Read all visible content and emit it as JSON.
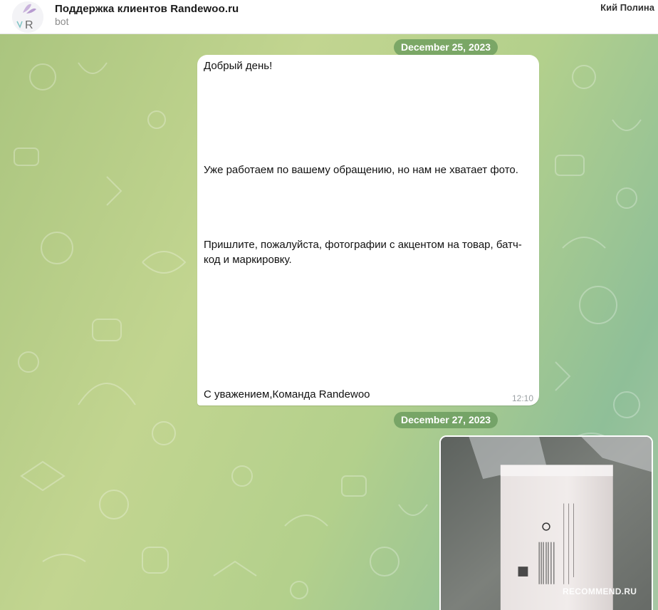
{
  "header": {
    "title": "Поддержка клиентов Randewoo.ru",
    "status": "bot",
    "user_name": "Кий Полина",
    "avatar_letter": "R"
  },
  "messages": [
    {
      "date": "December 25, 2023",
      "lines": [
        "Добрый день!",
        "Уже работаем по вашему обращению, но нам не хватает фото.",
        "Пришлите, пожалуйста, фотографии с акцентом на товар, батч-код и маркировку.",
        "С уважением,Команда Randewoo"
      ],
      "time": "12:10"
    },
    {
      "date": "December 27, 2023",
      "attachment": "photo"
    }
  ],
  "watermark": "RECOMMEND.RU"
}
